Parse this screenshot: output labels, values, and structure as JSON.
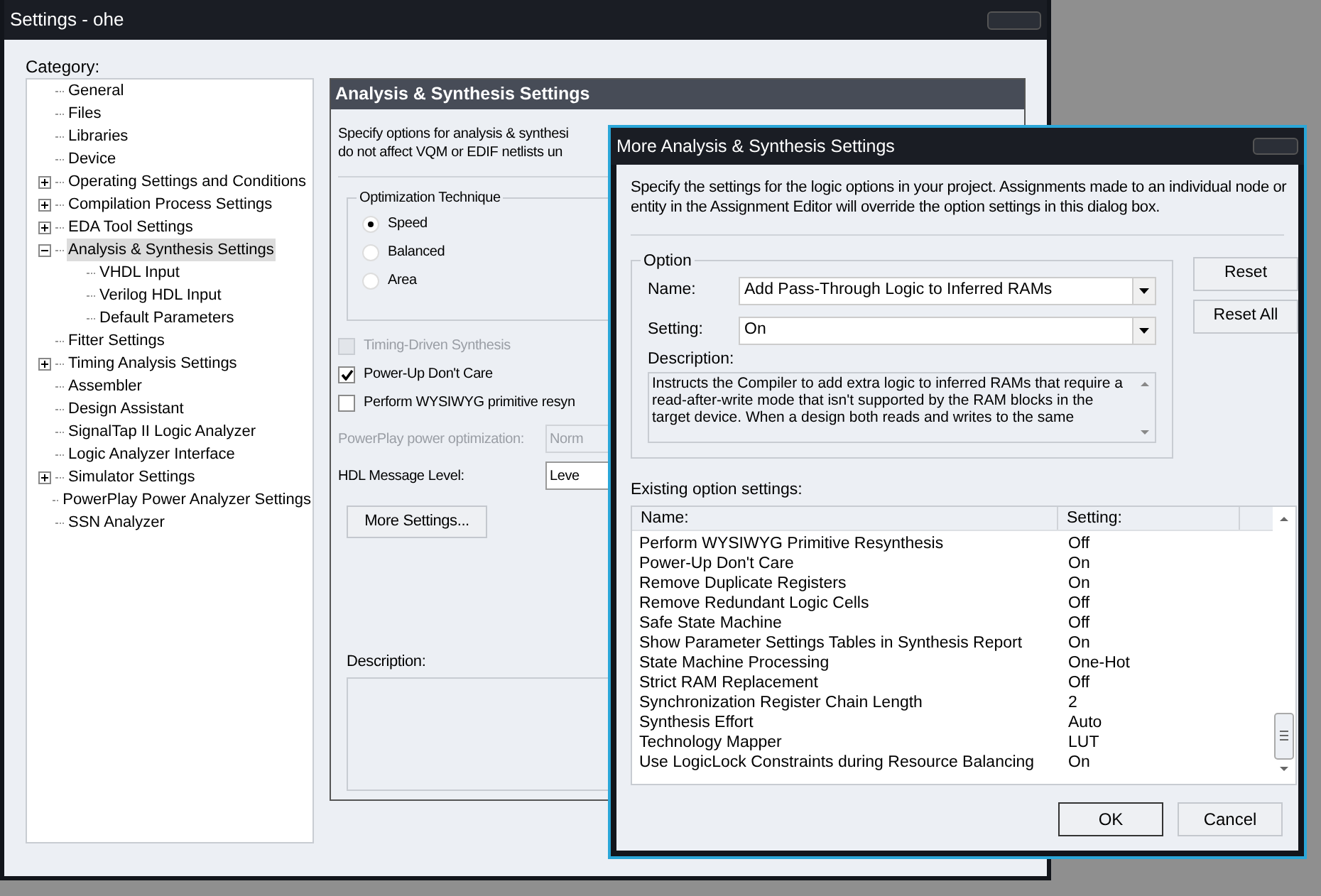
{
  "window": {
    "title": "Settings - ohe"
  },
  "category_label": "Category:",
  "tree": [
    {
      "label": "General",
      "kind": "leaf",
      "selected": false
    },
    {
      "label": "Files",
      "kind": "leaf",
      "selected": false
    },
    {
      "label": "Libraries",
      "kind": "leaf",
      "selected": false
    },
    {
      "label": "Device",
      "kind": "leaf",
      "selected": false
    },
    {
      "label": "Operating Settings and Conditions",
      "kind": "collapsed",
      "selected": false
    },
    {
      "label": "Compilation Process Settings",
      "kind": "collapsed",
      "selected": false
    },
    {
      "label": "EDA Tool Settings",
      "kind": "collapsed",
      "selected": false
    },
    {
      "label": "Analysis & Synthesis Settings",
      "kind": "expanded",
      "selected": true,
      "children": [
        {
          "label": "VHDL Input",
          "kind": "leaf",
          "selected": false
        },
        {
          "label": "Verilog HDL Input",
          "kind": "leaf",
          "selected": false
        },
        {
          "label": "Default Parameters",
          "kind": "leaf",
          "selected": false
        }
      ]
    },
    {
      "label": "Fitter Settings",
      "kind": "leaf",
      "selected": false
    },
    {
      "label": "Timing Analysis Settings",
      "kind": "collapsed",
      "selected": false
    },
    {
      "label": "Assembler",
      "kind": "leaf",
      "selected": false
    },
    {
      "label": "Design Assistant",
      "kind": "leaf",
      "selected": false
    },
    {
      "label": "SignalTap II Logic Analyzer",
      "kind": "leaf",
      "selected": false
    },
    {
      "label": "Logic Analyzer Interface",
      "kind": "leaf",
      "selected": false
    },
    {
      "label": "Simulator Settings",
      "kind": "collapsed",
      "selected": false
    },
    {
      "label": "PowerPlay Power Analyzer Settings",
      "kind": "leaf",
      "selected": false
    },
    {
      "label": "SSN Analyzer",
      "kind": "leaf",
      "selected": false
    }
  ],
  "panel": {
    "title": "Analysis & Synthesis Settings",
    "intro": [
      "Specify options for analysis & synthesi",
      "do not affect VQM or EDIF netlists un"
    ],
    "optimization": {
      "title": "Optimization Technique",
      "options": [
        {
          "label": "Speed",
          "selected": true
        },
        {
          "label": "Balanced",
          "selected": false
        },
        {
          "label": "Area",
          "selected": false
        }
      ]
    },
    "checkboxes": [
      {
        "label": "Timing-Driven Synthesis",
        "checked": false,
        "disabled": true
      },
      {
        "label": "Power-Up Don't Care",
        "checked": true,
        "disabled": false
      },
      {
        "label": "Perform WYSIWYG primitive resyn",
        "checked": false,
        "disabled": false
      }
    ],
    "combos": [
      {
        "label": "PowerPlay power optimization:",
        "value": "Norm",
        "disabled": true
      },
      {
        "label": "HDL Message Level:",
        "value": "Leve",
        "disabled": false
      }
    ],
    "more_button": "More Settings...",
    "description_label": "Description:"
  },
  "dialog": {
    "title": "More Analysis & Synthesis Settings",
    "intro": "Specify the settings for the logic options in your project.  Assignments made to an individual node or entity in the Assignment Editor will override the option settings in this dialog box.",
    "option_group": "Option",
    "name_label": "Name:",
    "name_value": "Add Pass-Through Logic to Inferred RAMs",
    "setting_label": "Setting:",
    "setting_value": "On",
    "description_label": "Description:",
    "description": "Instructs the Compiler to add extra logic to inferred RAMs that require a read-after-write mode that isn't supported by the RAM blocks in the target device.  When a design both reads and writes to the same",
    "side_buttons": [
      "Reset",
      "Reset All"
    ],
    "existing_label": "Existing option settings:",
    "table": {
      "columns": [
        "Name:",
        "Setting:"
      ],
      "rows": [
        [
          "Perform WYSIWYG Primitive Resynthesis",
          "Off"
        ],
        [
          "Power-Up Don't Care",
          "On"
        ],
        [
          "Remove Duplicate Registers",
          "On"
        ],
        [
          "Remove Redundant Logic Cells",
          "Off"
        ],
        [
          "Safe State Machine",
          "Off"
        ],
        [
          "Show Parameter Settings Tables in Synthesis Report",
          "On"
        ],
        [
          "State Machine Processing",
          "One-Hot"
        ],
        [
          "Strict RAM Replacement",
          "Off"
        ],
        [
          "Synchronization Register Chain Length",
          "2"
        ],
        [
          "Synthesis Effort",
          "Auto"
        ],
        [
          "Technology Mapper",
          "LUT"
        ],
        [
          "Use LogicLock Constraints during Resource Balancing",
          "On"
        ]
      ]
    },
    "buttons": [
      "OK",
      "Cancel"
    ]
  }
}
